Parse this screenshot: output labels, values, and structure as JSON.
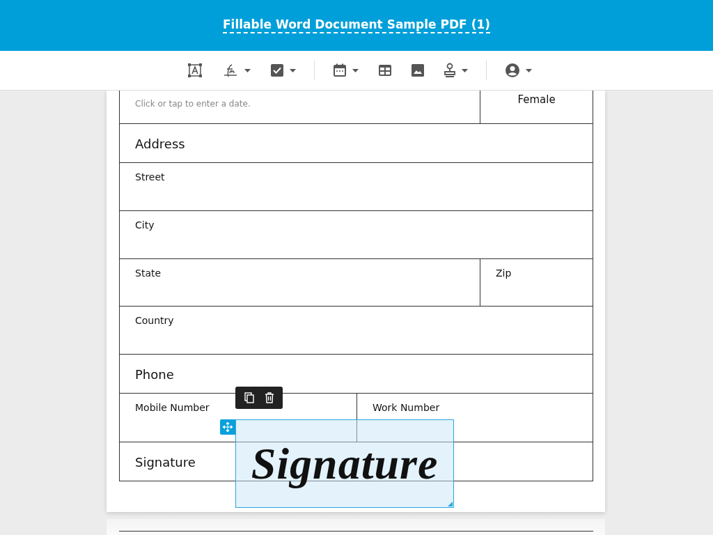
{
  "header": {
    "title": "Fillable Word Document Sample PDF (1)"
  },
  "toolbar": {
    "groups": [
      [
        {
          "kind": "text-field",
          "menu": false
        },
        {
          "kind": "signature",
          "menu": true
        },
        {
          "kind": "checkbox",
          "menu": true
        }
      ],
      [
        {
          "kind": "date",
          "menu": true
        },
        {
          "kind": "table",
          "menu": false
        },
        {
          "kind": "image",
          "menu": false
        },
        {
          "kind": "stamp",
          "menu": true
        }
      ],
      [
        {
          "kind": "user",
          "menu": true
        }
      ]
    ]
  },
  "form": {
    "rows": [
      {
        "kind": "wide-narrow",
        "cells": [
          {
            "hint": "Click or tap to enter a date."
          },
          {
            "value": "Female"
          }
        ]
      },
      {
        "kind": "heading",
        "cells": [
          {
            "label": "Address"
          }
        ]
      },
      {
        "kind": "single",
        "cells": [
          {
            "label": "Street"
          }
        ]
      },
      {
        "kind": "single",
        "cells": [
          {
            "label": "City"
          }
        ]
      },
      {
        "kind": "wide-narrow",
        "cells": [
          {
            "label": "State"
          },
          {
            "label": "Zip"
          }
        ]
      },
      {
        "kind": "single",
        "cells": [
          {
            "label": "Country"
          }
        ]
      },
      {
        "kind": "heading",
        "cells": [
          {
            "label": "Phone"
          }
        ]
      },
      {
        "kind": "half-half",
        "cells": [
          {
            "label": "Mobile Number"
          },
          {
            "label": "Work Number"
          }
        ]
      },
      {
        "kind": "heading",
        "cells": [
          {
            "label": "Signature"
          }
        ]
      }
    ]
  },
  "placed_signature": {
    "text": "Signature",
    "selected": true
  }
}
